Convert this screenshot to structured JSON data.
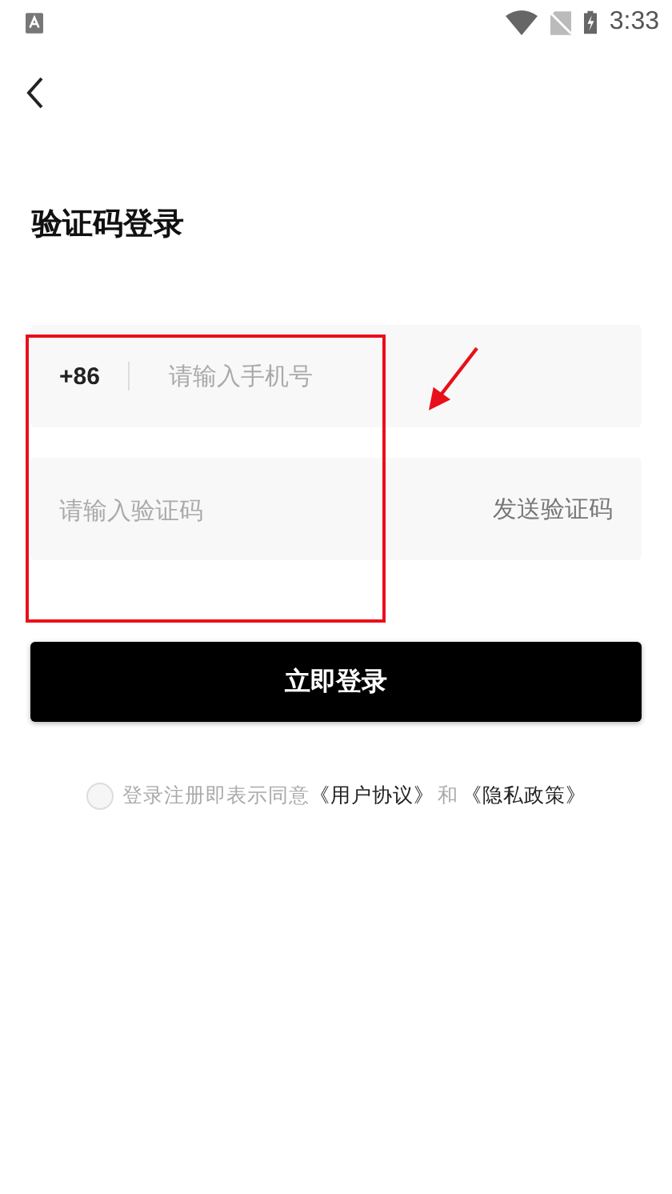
{
  "status_bar": {
    "time": "3:33"
  },
  "title": "验证码登录",
  "phone_field": {
    "country_code": "+86",
    "placeholder": "请输入手机号"
  },
  "code_field": {
    "placeholder": "请输入验证码",
    "send_button": "发送验证码"
  },
  "login_button": "立即登录",
  "agreement": {
    "checked": false,
    "text": "登录注册即表示同意",
    "link_1": "《用户协议》",
    "joiner": "和",
    "link_2": "《隐私政策》"
  },
  "annotations": {
    "frame": true,
    "arrow": true
  }
}
